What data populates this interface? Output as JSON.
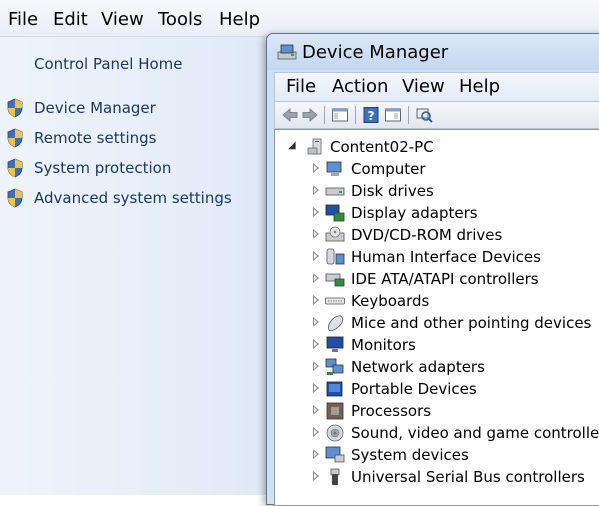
{
  "control_panel": {
    "menu": [
      "File",
      "Edit",
      "View",
      "Tools",
      "Help"
    ],
    "home_link": "Control Panel Home",
    "tasks": [
      {
        "label": "Device Manager",
        "icon": "uac-shield-icon"
      },
      {
        "label": "Remote settings",
        "icon": "uac-shield-icon"
      },
      {
        "label": "System protection",
        "icon": "uac-shield-icon"
      },
      {
        "label": "Advanced system settings",
        "icon": "uac-shield-icon"
      }
    ]
  },
  "device_manager": {
    "title": "Device Manager",
    "menu": [
      "File",
      "Action",
      "View",
      "Help"
    ],
    "toolbar": [
      "back-arrow-icon",
      "forward-arrow-icon",
      "show-hide-console-tree-icon",
      "help-icon",
      "properties-icon",
      "scan-hardware-icon"
    ],
    "tree": {
      "root": "Content02-PC",
      "nodes": [
        {
          "label": "Computer",
          "icon": "computer-icon"
        },
        {
          "label": "Disk drives",
          "icon": "disk-drive-icon"
        },
        {
          "label": "Display adapters",
          "icon": "display-adapter-icon"
        },
        {
          "label": "DVD/CD-ROM drives",
          "icon": "dvd-drive-icon"
        },
        {
          "label": "Human Interface Devices",
          "icon": "hid-icon"
        },
        {
          "label": "IDE ATA/ATAPI controllers",
          "icon": "ide-controller-icon"
        },
        {
          "label": "Keyboards",
          "icon": "keyboard-icon"
        },
        {
          "label": "Mice and other pointing devices",
          "icon": "mouse-icon"
        },
        {
          "label": "Monitors",
          "icon": "monitor-icon"
        },
        {
          "label": "Network adapters",
          "icon": "network-adapter-icon"
        },
        {
          "label": "Portable Devices",
          "icon": "portable-device-icon"
        },
        {
          "label": "Processors",
          "icon": "processor-icon"
        },
        {
          "label": "Sound, video and game controllers",
          "icon": "speaker-icon"
        },
        {
          "label": "System devices",
          "icon": "system-device-icon"
        },
        {
          "label": "Universal Serial Bus controllers",
          "icon": "usb-icon"
        }
      ]
    }
  },
  "colors": {
    "link": "#1e3760",
    "panel_bg": "#e6eef9",
    "window_frame": "#cfe0f3"
  }
}
